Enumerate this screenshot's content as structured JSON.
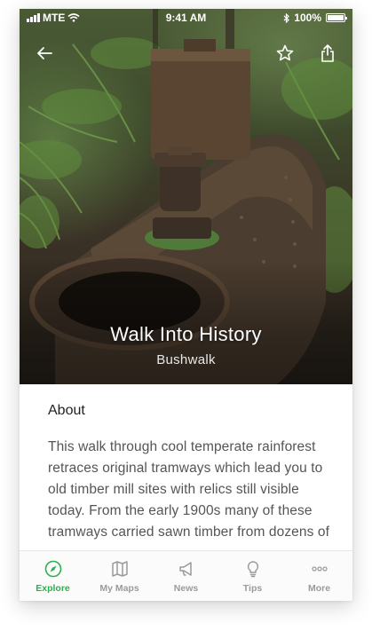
{
  "status_bar": {
    "carrier": "MTE",
    "time": "9:41 AM",
    "battery": "100%"
  },
  "hero": {
    "title": "Walk Into History",
    "subtitle": "Bushwalk"
  },
  "nav": {
    "back_icon": "arrow-left-icon",
    "favorite_icon": "star-icon",
    "share_icon": "share-icon"
  },
  "about": {
    "heading": "About",
    "body": "This walk through cool temperate rainforest retraces original tramways which lead you to old timber mill sites with relics still visible today. From the early 1900s many of these tramways carried sawn timber from dozens of"
  },
  "tabbar": {
    "items": [
      {
        "label": "Explore",
        "icon": "compass-icon",
        "active": true
      },
      {
        "label": "My Maps",
        "icon": "map-icon",
        "active": false
      },
      {
        "label": "News",
        "icon": "megaphone-icon",
        "active": false
      },
      {
        "label": "Tips",
        "icon": "lightbulb-icon",
        "active": false
      },
      {
        "label": "More",
        "icon": "more-icon",
        "active": false
      }
    ]
  },
  "colors": {
    "accent": "#2bb24c",
    "tab_inactive": "#9a9a9a"
  }
}
